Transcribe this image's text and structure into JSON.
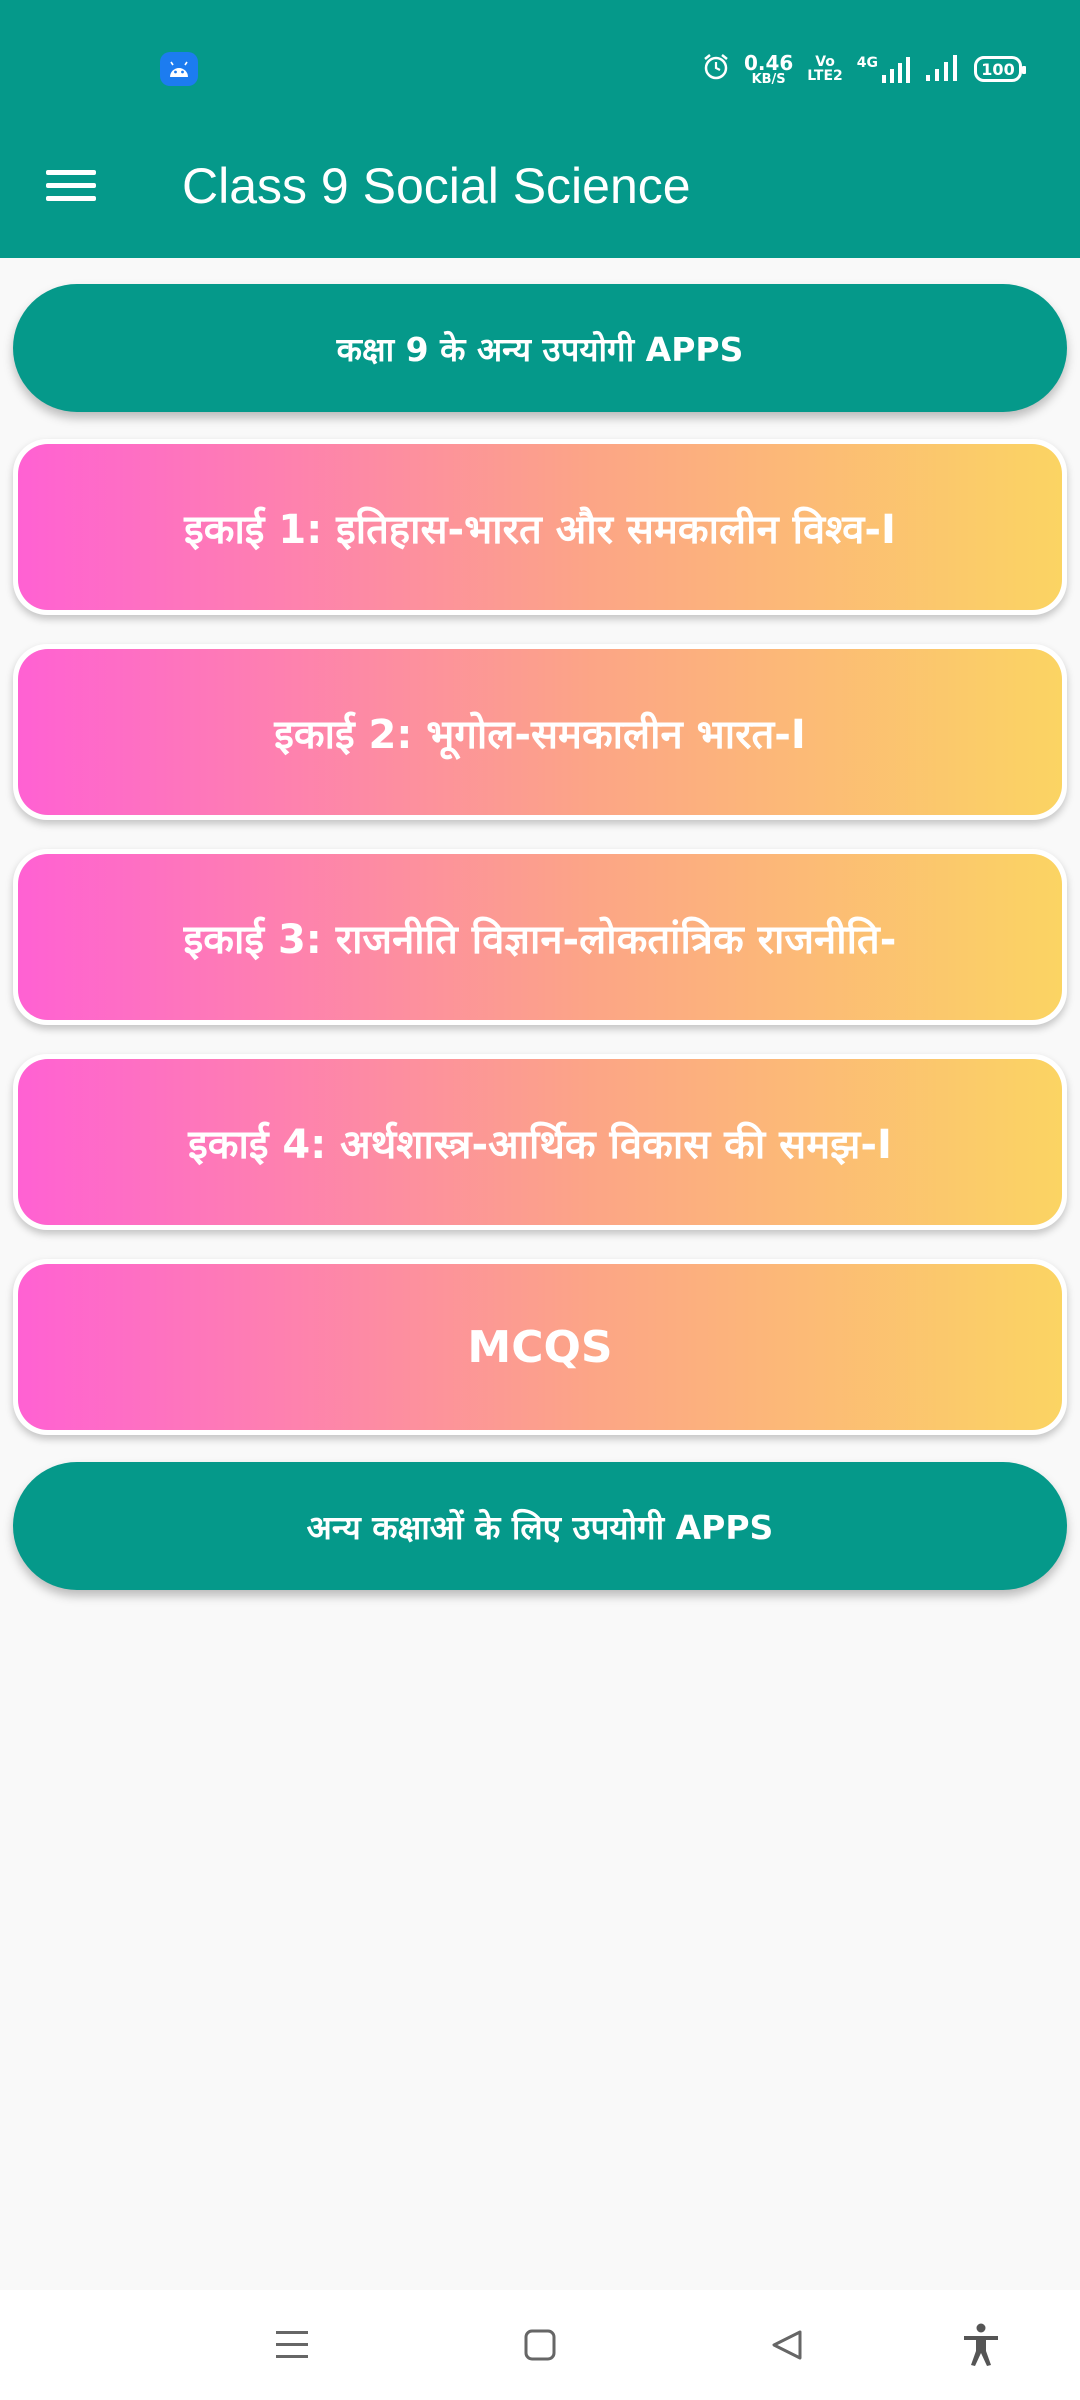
{
  "status_bar": {
    "speed_value": "0.46",
    "speed_unit": "KB/S",
    "volte_top": "Vo",
    "volte_bottom": "LTE2",
    "network": "4G",
    "battery": "100",
    "icons": [
      "android-icon",
      "alarm-icon",
      "signal-icon",
      "battery-icon"
    ]
  },
  "app_bar": {
    "title": "Class 9 Social Science",
    "menu_icon": "hamburger-menu-icon",
    "color": "#05998a"
  },
  "main": {
    "top_button": "कक्षा 9 के अन्य उपयोगी APPS",
    "units": [
      {
        "label": "इकाई 1: इतिहास-भारत और समकालीन विश्व-I"
      },
      {
        "label": "इकाई 2: भूगोल-समकालीन भारत-I"
      },
      {
        "label": "इकाई 3: राजनीति विज्ञान-लोकतांत्रिक राजनीति-"
      },
      {
        "label": "इकाई 4: अर्थशास्त्र-आर्थिक विकास की समझ-I"
      },
      {
        "label": "MCQS"
      }
    ],
    "bottom_button": "अन्य कक्षाओं के लिए उपयोगी APPS",
    "gradient": {
      "start": "#ff61d3",
      "end": "#fbd463"
    }
  },
  "nav_bar": {
    "buttons": [
      "recents-icon",
      "home-icon",
      "back-icon",
      "accessibility-icon"
    ]
  }
}
